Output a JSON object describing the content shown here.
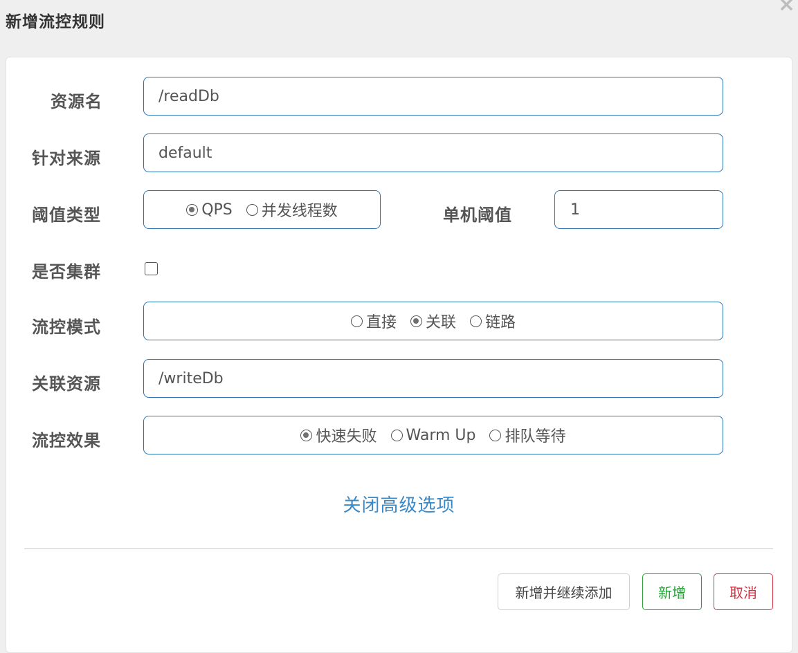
{
  "dialog": {
    "title": "新增流控规则",
    "close_label": "×"
  },
  "form": {
    "resource_name": {
      "label": "资源名",
      "value": "/readDb"
    },
    "limit_app": {
      "label": "针对来源",
      "value": "default"
    },
    "threshold_type": {
      "label": "阈值类型",
      "options": [
        {
          "label": "QPS",
          "checked": true
        },
        {
          "label": "并发线程数",
          "checked": false
        }
      ]
    },
    "single_threshold": {
      "label": "单机阈值",
      "value": "1"
    },
    "cluster": {
      "label": "是否集群",
      "checked": false
    },
    "control_mode": {
      "label": "流控模式",
      "options": [
        {
          "label": "直接",
          "checked": false
        },
        {
          "label": "关联",
          "checked": true
        },
        {
          "label": "链路",
          "checked": false
        }
      ]
    },
    "ref_resource": {
      "label": "关联资源",
      "value": "/writeDb"
    },
    "control_effect": {
      "label": "流控效果",
      "options": [
        {
          "label": "快速失败",
          "checked": true
        },
        {
          "label": "Warm Up",
          "checked": false
        },
        {
          "label": "排队等待",
          "checked": false
        }
      ]
    },
    "advanced_toggle": "关闭高级选项"
  },
  "footer": {
    "add_continue_label": "新增并继续添加",
    "add_label": "新增",
    "cancel_label": "取消"
  },
  "colors": {
    "input_border": "#2b72b5",
    "link": "#3a8ac9",
    "success": "#2a9c3a",
    "danger": "#d03142"
  }
}
